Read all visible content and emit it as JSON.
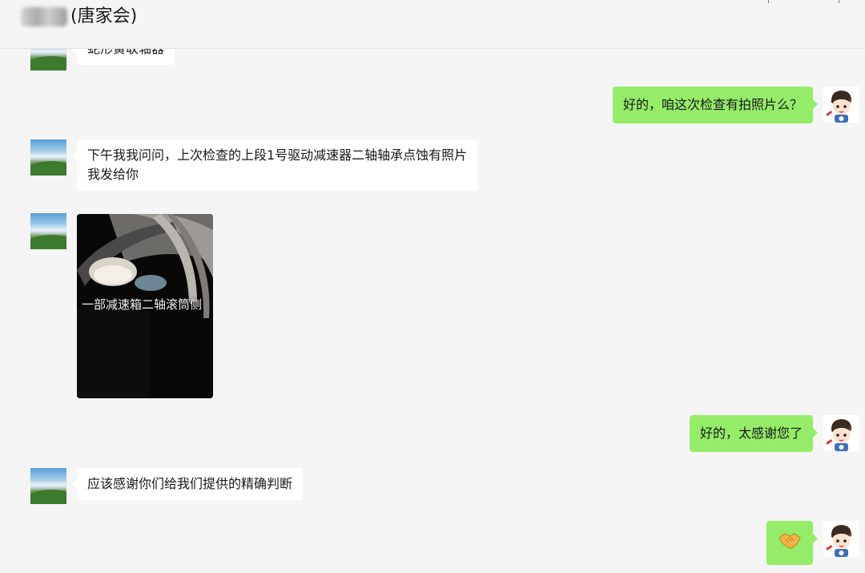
{
  "header": {
    "title": "(唐家会)"
  },
  "messages": [
    {
      "side": "left",
      "type": "text",
      "text": "蛇形簧联轴器"
    },
    {
      "side": "right",
      "type": "text",
      "text": "好的，咱这次检查有拍照片么？"
    },
    {
      "side": "left",
      "type": "text",
      "text": "下午我我问问，上次检查的上段1号驱动减速器二轴轴承点蚀有照片\n我发给你"
    },
    {
      "side": "left",
      "type": "image",
      "caption": "一部减速箱二轴滚筒侧"
    },
    {
      "side": "right",
      "type": "text",
      "text": "好的，太感谢您了"
    },
    {
      "side": "left",
      "type": "text",
      "text": "应该感谢你们给我们提供的精确判断"
    },
    {
      "side": "right",
      "type": "emoji",
      "icon": "handshake-emoji"
    }
  ],
  "colors": {
    "background": "#f5f5f5",
    "bubble_self": "#95ec69",
    "bubble_other": "#ffffff"
  }
}
